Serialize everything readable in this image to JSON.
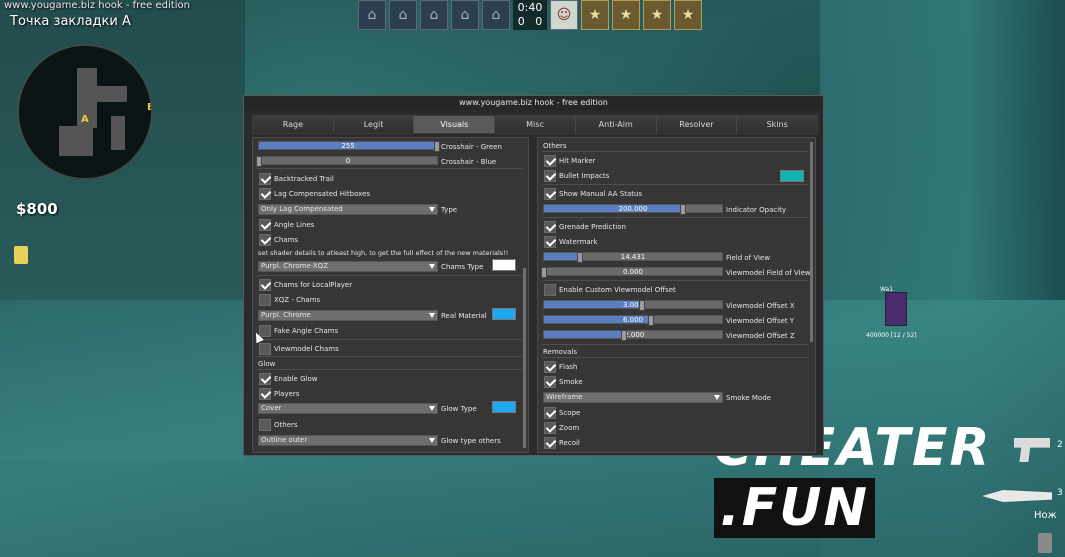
{
  "hud": {
    "site_label": "www.yougame.biz hook - free edition",
    "bomb_site": "Точка закладки А",
    "radar_b": "B",
    "radar_a": "A",
    "money": "$800",
    "timer": "0:40",
    "score_ct": "0",
    "score_t": "0",
    "player_name": "Wa1",
    "player_hp": "400000 [12 / 52]",
    "slot_gun": "2",
    "slot_knife": "3",
    "knife_label": "Нож",
    "watermark_a": "CHEATER",
    "watermark_b": ".FUN"
  },
  "menu": {
    "title": "www.yougame.biz hook - free edition",
    "tabs": [
      "Rage",
      "Legit",
      "Visuals",
      "Misc",
      "Anti-Aim",
      "Resolver",
      "Skins"
    ],
    "active_tab": "Visuals",
    "left": {
      "crosshair_green_val": "255",
      "crosshair_green_label": "Crosshair - Green",
      "crosshair_green_fill": 1.0,
      "crosshair_blue_val": "0",
      "crosshair_blue_label": "Crosshair - Blue",
      "crosshair_blue_fill": 0.0,
      "backtracked_trail": "Backtracked Trail",
      "lag_comp": "Lag Compensated Hitboxes",
      "type_value": "Only Lag Compensated",
      "type_label": "Type",
      "angle_lines": "Angle Lines",
      "chams": "Chams",
      "shader_note": "set shader details to atleast high, to get the full effect of the new materials!!",
      "chams_type_value": "Purpl. Chrome-XQZ",
      "chams_type_label": "Chams Type",
      "chams_local": "Chams for LocalPlayer",
      "xqz_chams": "XQZ - Chams",
      "real_material_value": "Purpl. Chrome",
      "real_material_label": "Real Material",
      "fake_angle_chams": "Fake Angle Chams",
      "viewmodel_chams": "Viewmodel Chams",
      "glow_section": "Glow",
      "enable_glow": "Enable Glow",
      "players": "Players",
      "glow_type_value": "Cover",
      "glow_type_label": "Glow Type",
      "others": "Others",
      "glow_others_value": "Outline outer",
      "glow_others_label": "Glow type others"
    },
    "right": {
      "others_section": "Others",
      "hit_marker": "Hit Marker",
      "bullet_impacts": "Bullet Impacts",
      "show_manual_aa": "Show Manual AA Status",
      "indicator_opacity_val": "200.000",
      "indicator_opacity_label": "Indicator Opacity",
      "indicator_opacity_fill": 0.78,
      "grenade_prediction": "Grenade Prediction",
      "watermark": "Watermark",
      "fov_val": "14.431",
      "fov_label": "Field of View",
      "fov_fill": 0.2,
      "vm_fov_val": "0.000",
      "vm_fov_label": "Viewmodel Field of View",
      "vm_fov_fill": 0.0,
      "custom_vm_offset": "Enable Custom Viewmodel Offset",
      "vm_x_val": "3.000",
      "vm_x_label": "Viewmodel Offset X",
      "vm_x_fill": 0.55,
      "vm_y_val": "6.000",
      "vm_y_label": "Viewmodel Offset Y",
      "vm_y_fill": 0.6,
      "vm_z_val": "-2.000",
      "vm_z_label": "Viewmodel Offset Z",
      "vm_z_fill": 0.45,
      "removals_section": "Removals",
      "flash": "Flash",
      "smoke": "Smoke",
      "smoke_mode_value": "Wireframe",
      "smoke_mode_label": "Smoke Mode",
      "scope": "Scope",
      "zoom": "Zoom",
      "recoil": "Recoil"
    },
    "colors": {
      "chams_type_swatch": "#ffffff",
      "real_material_swatch": "#1ea7f2",
      "glow_type_swatch": "#1ea7f2",
      "bullet_impacts_swatch": "#11b3b0",
      "slider_fill": "#5b7ec2"
    }
  }
}
